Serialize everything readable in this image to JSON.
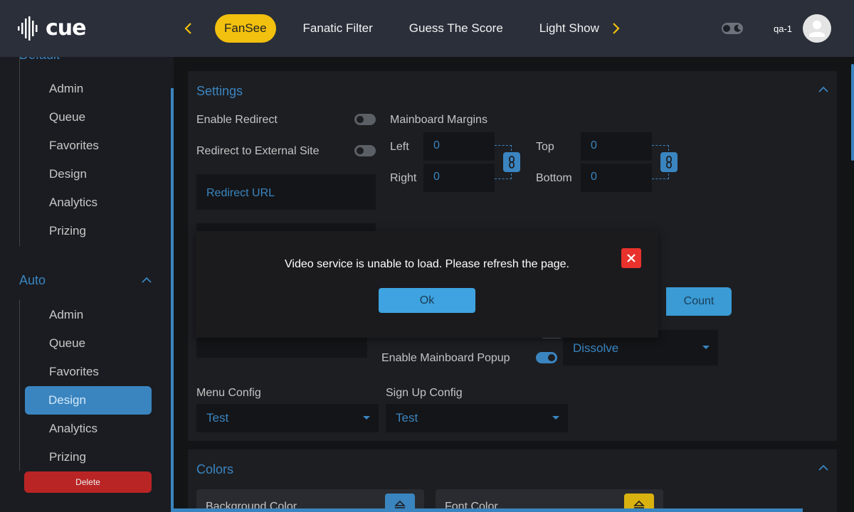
{
  "header": {
    "logo_text": "cue",
    "tabs": [
      {
        "label": "FanSee",
        "active": true
      },
      {
        "label": "Fanatic Filter",
        "active": false
      },
      {
        "label": "Guess The Score",
        "active": false
      },
      {
        "label": "Light Show",
        "active": false
      }
    ],
    "user": "qa-1",
    "accent_color": "#f2c00e"
  },
  "sidebar": {
    "clipped_title": "Default",
    "group1": [
      "Admin",
      "Queue",
      "Favorites",
      "Design",
      "Analytics",
      "Prizing"
    ],
    "section_title": "Auto",
    "group2": [
      "Admin",
      "Queue",
      "Favorites",
      "Design",
      "Analytics",
      "Prizing"
    ],
    "active_item": "Design",
    "delete_label": "Delete"
  },
  "settings": {
    "title": "Settings",
    "enable_redirect": "Enable Redirect",
    "redirect_external": "Redirect to External Site",
    "redirect_url_placeholder": "Redirect URL",
    "mainboard_margins": "Mainboard Margins",
    "left": "Left",
    "right": "Right",
    "top": "Top",
    "bottom": "Bottom",
    "left_value": "0",
    "right_value": "0",
    "top_value": "0",
    "bottom_value": "0",
    "count_label": "Count",
    "enable_mainboard_popup": "Enable Mainboard Popup",
    "transition_value": "Dissolve",
    "menu_config": "Menu Config",
    "menu_config_value": "Test",
    "signup_config": "Sign Up Config",
    "signup_config_value": "Test"
  },
  "colors": {
    "title": "Colors",
    "background_color": "Background Color",
    "font_color": "Font Color"
  },
  "modal": {
    "message": "Video service is unable to load. Please refresh the page.",
    "ok_label": "Ok"
  }
}
